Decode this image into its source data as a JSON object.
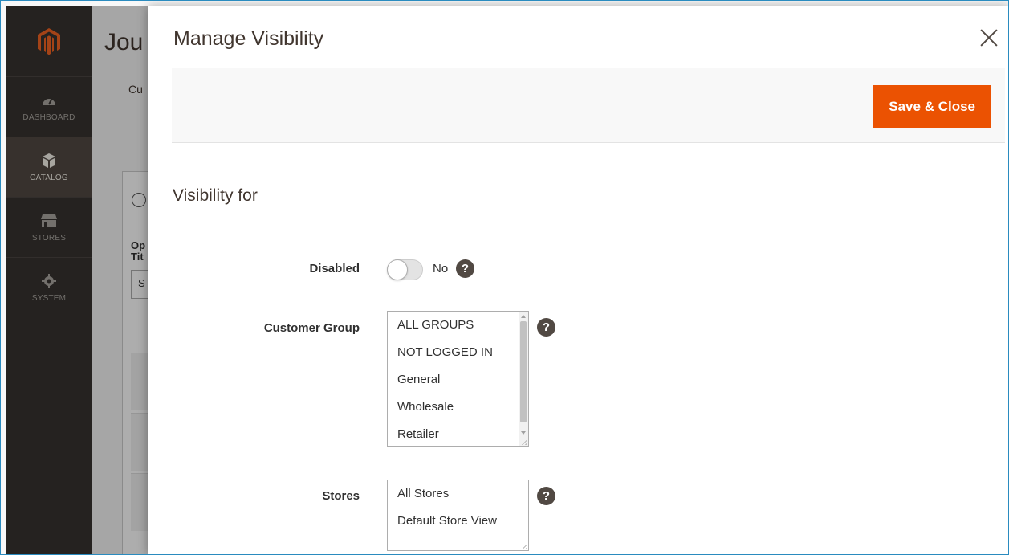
{
  "sidebar": {
    "logo": "magento-logo",
    "items": [
      {
        "label": "DASHBOARD",
        "icon": "dashboard-icon"
      },
      {
        "label": "CATALOG",
        "icon": "catalog-icon"
      },
      {
        "label": "STORES",
        "icon": "stores-icon"
      },
      {
        "label": "SYSTEM",
        "icon": "system-icon"
      }
    ]
  },
  "background": {
    "title": "Jou",
    "crumb": "Cu",
    "options_label": "Op",
    "title_label": "Tit",
    "input_value": "S"
  },
  "modal": {
    "title": "Manage Visibility",
    "save_label": "Save & Close",
    "section_title": "Visibility for",
    "disabled": {
      "label": "Disabled",
      "state_text": "No"
    },
    "customer_group": {
      "label": "Customer Group",
      "options": [
        "ALL GROUPS",
        "NOT LOGGED IN",
        "General",
        "Wholesale",
        "Retailer"
      ]
    },
    "stores": {
      "label": "Stores",
      "options": [
        "All Stores",
        "Default Store View"
      ]
    },
    "help_glyph": "?"
  },
  "colors": {
    "sidebar": "#373330",
    "accent": "#eb5202",
    "help": "#514943"
  }
}
